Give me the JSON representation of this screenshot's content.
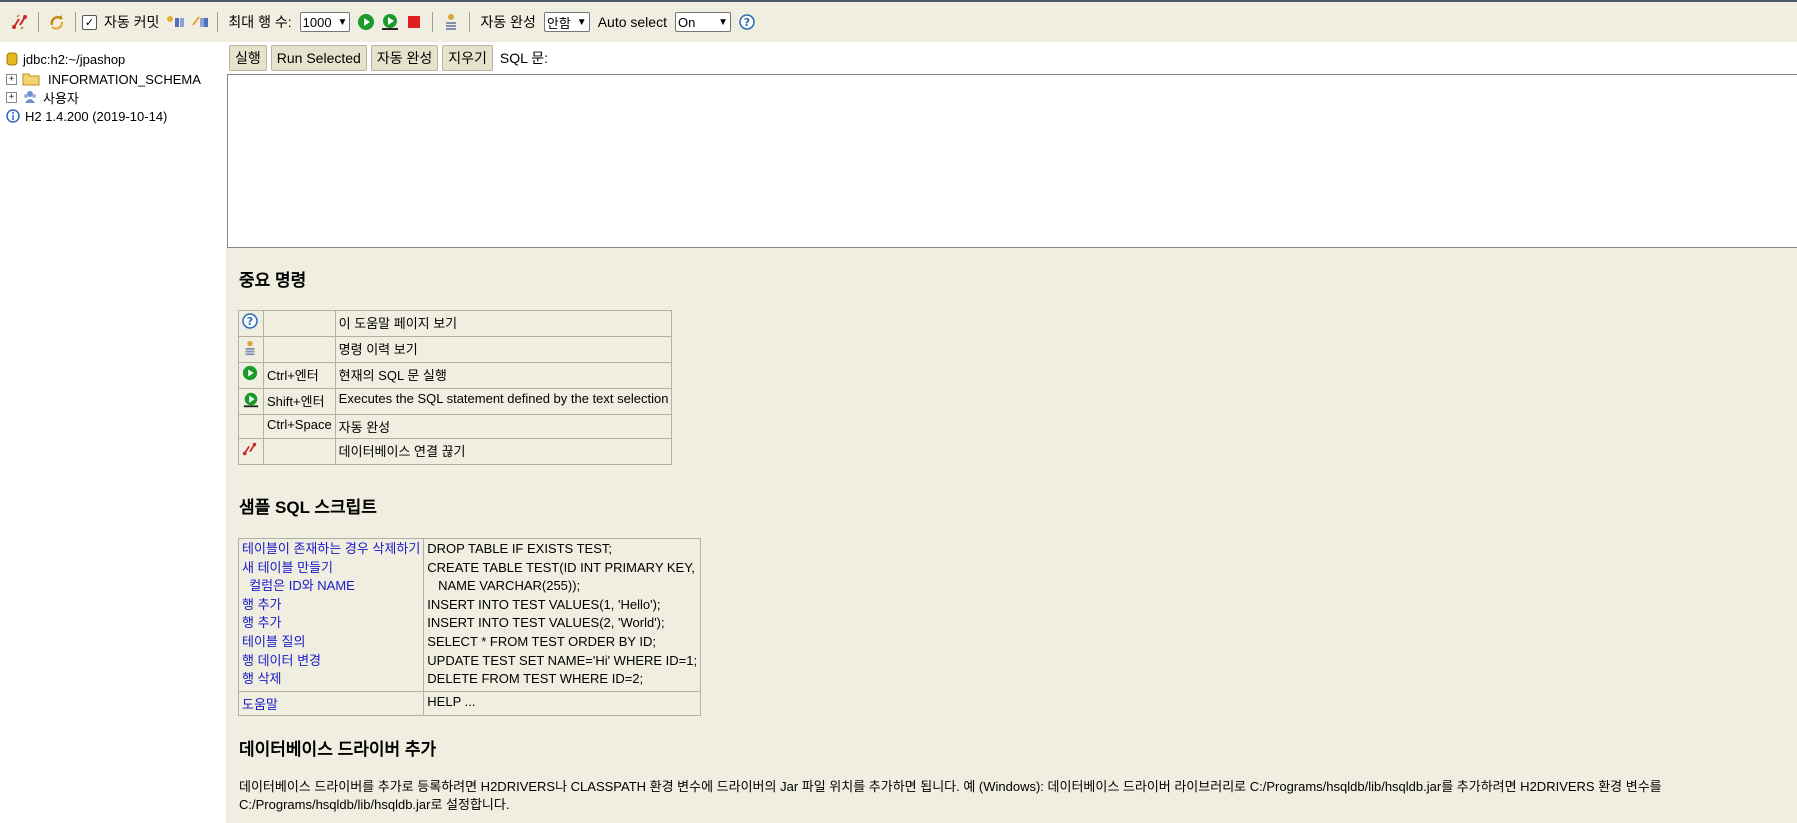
{
  "toolbar": {
    "auto_commit_label": "자동 커밋",
    "max_rows_label": "최대 행 수:",
    "max_rows_value": "1000",
    "auto_complete_label": "자동 완성",
    "auto_complete_value": "안함",
    "auto_select_label": "Auto select",
    "auto_select_value": "On",
    "icons": [
      "disconnect-icon",
      "refresh-icon",
      "rollback-icon",
      "commit-icon",
      "run-icon",
      "run-selected-icon",
      "stop-icon",
      "history-icon",
      "help-icon"
    ]
  },
  "tree": {
    "connection": "jdbc:h2:~/jpashop",
    "items": [
      "INFORMATION_SCHEMA",
      "사용자"
    ],
    "version": "H2 1.4.200 (2019-10-14)"
  },
  "query": {
    "run_label": "실행",
    "run_selected_label": "Run Selected",
    "auto_complete_label": "자동 완성",
    "clear_label": "지우기",
    "sql_label": "SQL 문:",
    "sql_text": ""
  },
  "help": {
    "important_title": "중요 명령",
    "commands": [
      {
        "icon": "help-icon",
        "key": "",
        "desc": "이 도움말 페이지 보기"
      },
      {
        "icon": "history-icon",
        "key": "",
        "desc": "명령 이력 보기"
      },
      {
        "icon": "run-icon",
        "key": "Ctrl+엔터",
        "desc": "현재의 SQL 문 실행"
      },
      {
        "icon": "run-selected-icon",
        "key": "Shift+엔터",
        "desc": "Executes the SQL statement defined by the text selection"
      },
      {
        "icon": "",
        "key": "Ctrl+Space",
        "desc": "자동 완성"
      },
      {
        "icon": "disconnect-icon",
        "key": "",
        "desc": "데이터베이스 연결 끊기"
      }
    ],
    "sample_title": "샘플 SQL 스크립트",
    "samples": [
      {
        "label": "테이블이 존재하는 경우 삭제하기",
        "sql": "DROP TABLE IF EXISTS TEST;"
      },
      {
        "label": "새 테이블 만들기",
        "sql": "CREATE TABLE TEST(ID INT PRIMARY KEY,"
      },
      {
        "label": "  컬럼은 ID와 NAME",
        "sql": "   NAME VARCHAR(255));"
      },
      {
        "label": "행 추가",
        "sql": "INSERT INTO TEST VALUES(1, 'Hello');"
      },
      {
        "label": "행 추가",
        "sql": "INSERT INTO TEST VALUES(2, 'World');"
      },
      {
        "label": "테이블 질의",
        "sql": "SELECT * FROM TEST ORDER BY ID;"
      },
      {
        "label": "행 데이터 변경",
        "sql": "UPDATE TEST SET NAME='Hi' WHERE ID=1;"
      },
      {
        "label": "행 삭제",
        "sql": "DELETE FROM TEST WHERE ID=2;"
      }
    ],
    "help_row": {
      "label": "도움말",
      "sql": "HELP ..."
    },
    "driver_title": "데이터베이스 드라이버 추가",
    "driver_text": "데이터베이스 드라이버를 추가로 등록하려면 H2DRIVERS나 CLASSPATH 환경 변수에 드라이버의 Jar 파일 위치를 추가하면 됩니다. 예 (Windows): 데이터베이스 드라이버 라이브러리로 C:/Programs/hsqldb/lib/hsqldb.jar를 추가하려면 H2DRIVERS 환경 변수를 C:/Programs/hsqldb/lib/hsqldb.jar로 설정합니다."
  },
  "colors": {
    "panel": "#f0eee0",
    "link": "#1a1ac8",
    "button": "#e6e3cc",
    "run_green": "#1a9a2a",
    "stop_red": "#e02020"
  }
}
